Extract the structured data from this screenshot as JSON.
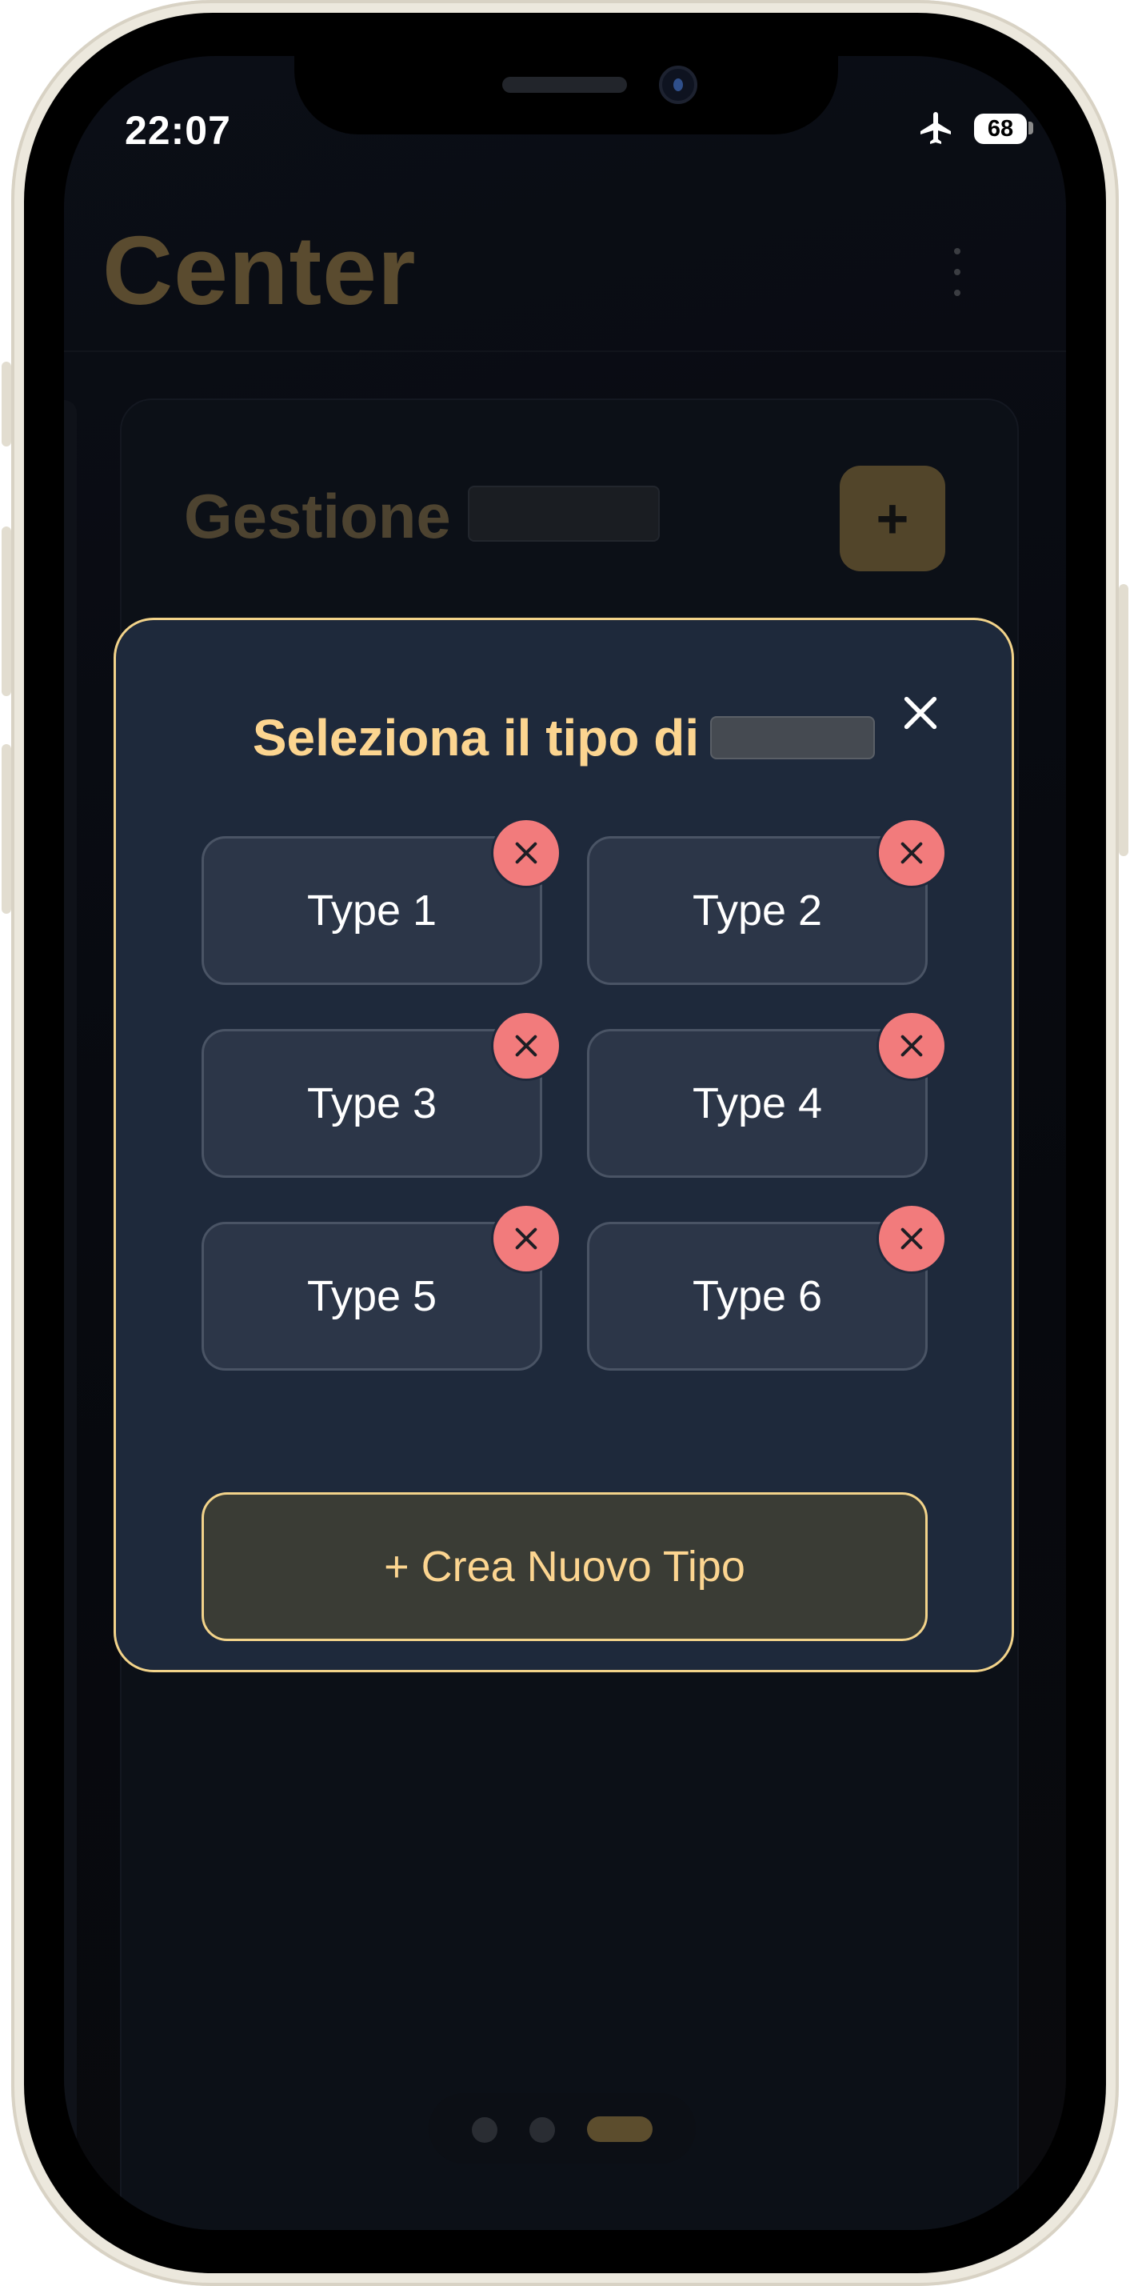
{
  "status_bar": {
    "time": "22:07",
    "battery_level": "68",
    "icons": [
      "airplane-icon",
      "battery-icon"
    ]
  },
  "app": {
    "title": "Center",
    "card_title": "Gestione",
    "add_label": "+"
  },
  "modal": {
    "title": "Seleziona il tipo di",
    "close_icon": "close-icon",
    "types": [
      {
        "label": "Type 1"
      },
      {
        "label": "Type 2"
      },
      {
        "label": "Type 3"
      },
      {
        "label": "Type 4"
      },
      {
        "label": "Type 5"
      },
      {
        "label": "Type 6"
      }
    ],
    "create_label": "+ Crea Nuovo Tipo"
  },
  "pagination": {
    "pages": 3,
    "active_page": 3
  },
  "colors": {
    "accent": "#fcd590",
    "modal_bg": "#1e293b",
    "delete": "#f27b7c",
    "type_button_bg": "#2c3648"
  }
}
